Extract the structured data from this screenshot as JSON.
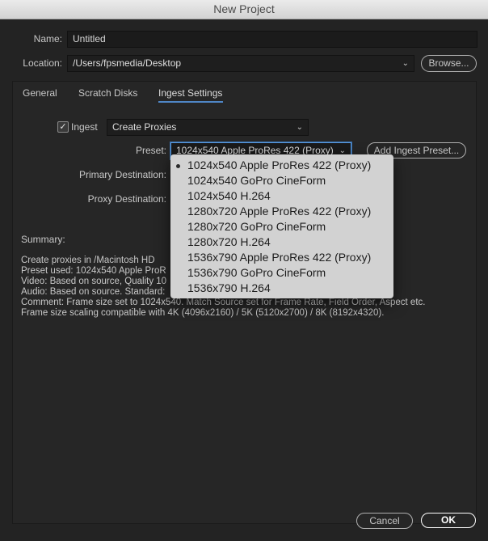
{
  "window": {
    "title": "New Project"
  },
  "form": {
    "name_label": "Name:",
    "name_value": "Untitled",
    "location_label": "Location:",
    "location_value": "/Users/fpsmedia/Desktop",
    "browse_label": "Browse..."
  },
  "tabs": [
    {
      "label": "General",
      "active": false
    },
    {
      "label": "Scratch Disks",
      "active": false
    },
    {
      "label": "Ingest Settings",
      "active": true
    }
  ],
  "ingest": {
    "checkbox_label": "Ingest",
    "checked": true,
    "action_value": "Create Proxies",
    "preset_label": "Preset:",
    "preset_value": "1024x540 Apple ProRes 422 (Proxy)",
    "add_preset_label": "Add Ingest Preset...",
    "primary_destination_label": "Primary Destination:",
    "proxy_destination_label": "Proxy Destination:"
  },
  "summary": {
    "label": "Summary:",
    "lines": [
      "Create proxies in /Macintosh HD",
      "Preset used: 1024x540 Apple ProR",
      "Video: Based on source, Quality 10",
      "Audio: Based on source. Standard:",
      "Comment: Frame size set to 1024x540. Match Source set for Frame Rate, Field Order, Aspect etc.",
      "Frame size scaling compatible with 4K (4096x2160) / 5K (5120x2700) / 8K (8192x4320)."
    ]
  },
  "preset_menu": {
    "selected_index": 0,
    "items": [
      "1024x540 Apple ProRes 422 (Proxy)",
      "1024x540 GoPro CineForm",
      "1024x540 H.264",
      "1280x720 Apple ProRes 422 (Proxy)",
      "1280x720 GoPro CineForm",
      "1280x720 H.264",
      "1536x790 Apple ProRes 422 (Proxy)",
      "1536x790 GoPro CineForm",
      "1536x790 H.264"
    ]
  },
  "footer": {
    "cancel_label": "Cancel",
    "ok_label": "OK"
  },
  "icons": {
    "dropdown": "chevron-down-icon",
    "check": "checkmark-icon",
    "selected": "bullet-icon"
  },
  "colors": {
    "accent": "#4f86c6",
    "background": "#232323",
    "menu_bg": "#d2d2d2"
  }
}
